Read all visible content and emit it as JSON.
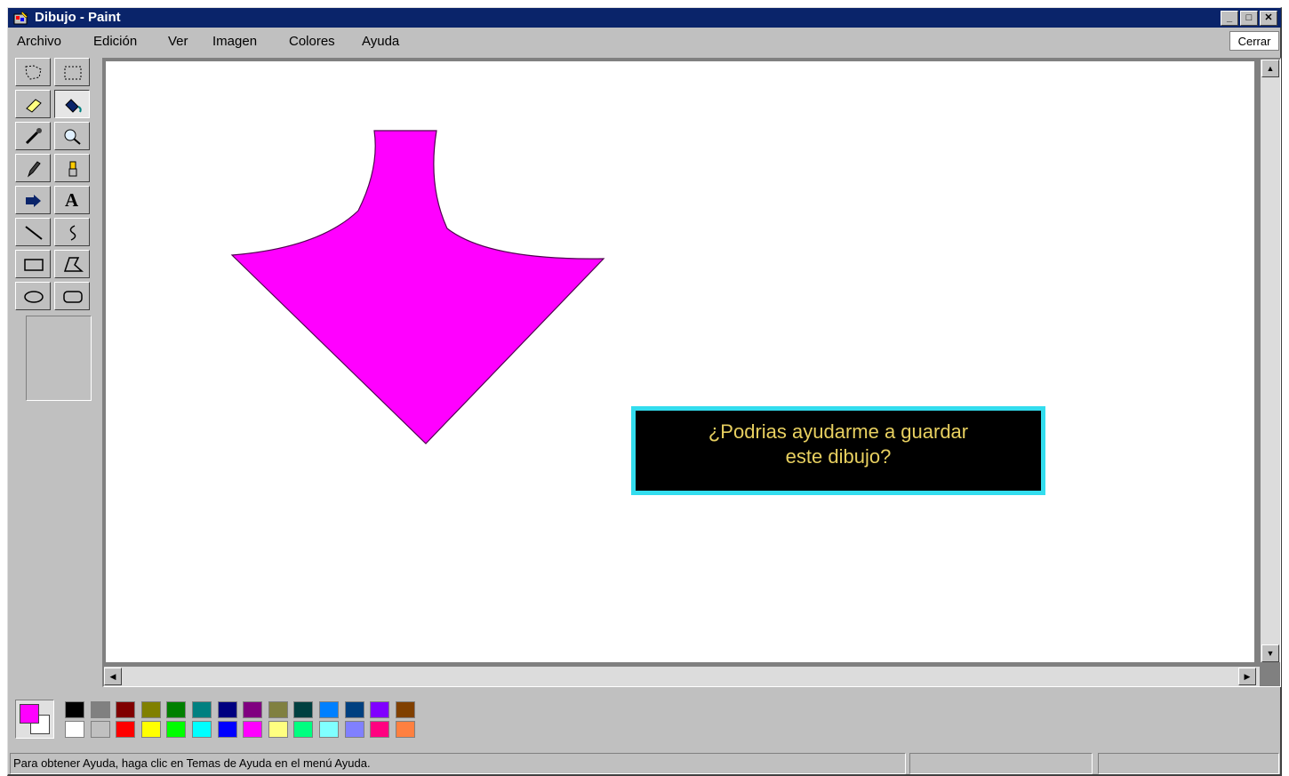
{
  "window": {
    "title": "Dibujo - Paint",
    "controls": [
      "_",
      "□",
      "✕"
    ]
  },
  "menu": {
    "items": [
      "Archivo",
      "Edición",
      "Ver",
      "Imagen",
      "Colores",
      "Ayuda"
    ],
    "close_label": "Cerrar"
  },
  "toolbox": {
    "tools": [
      "free-form-select-icon",
      "select-icon",
      "eraser-icon",
      "fill-icon",
      "pick-color-icon",
      "magnifier-icon",
      "pencil-icon",
      "brush-icon",
      "airbrush-icon",
      "text-icon",
      "line-icon",
      "curve-icon",
      "rectangle-icon",
      "polygon-icon",
      "ellipse-icon",
      "rounded-rectangle-icon"
    ],
    "active_tool": "fill-icon",
    "text_tool_glyph": "A"
  },
  "canvas": {
    "shape_color": "#ff00ff",
    "dialog": {
      "line1": "¿Podrias ayudarme a guardar",
      "line2": "este dibujo?",
      "border_color": "#33ddee",
      "text_color": "#e8d060"
    }
  },
  "palette": {
    "foreground": "#ff00ff",
    "background": "#ffffff",
    "top_row": [
      "#000000",
      "#808080",
      "#800000",
      "#808000",
      "#008000",
      "#008080",
      "#000080",
      "#800080",
      "#808040",
      "#004040",
      "#0080ff",
      "#004080",
      "#8000ff",
      "#804000"
    ],
    "bottom_row": [
      "#ffffff",
      "#c0c0c0",
      "#ff0000",
      "#ffff00",
      "#00ff00",
      "#00ffff",
      "#0000ff",
      "#ff00ff",
      "#ffff80",
      "#00ff80",
      "#80ffff",
      "#8080ff",
      "#ff0080",
      "#ff8040"
    ]
  },
  "status": {
    "help_text": "Para obtener Ayuda, haga clic en Temas de Ayuda en el menú Ayuda."
  }
}
